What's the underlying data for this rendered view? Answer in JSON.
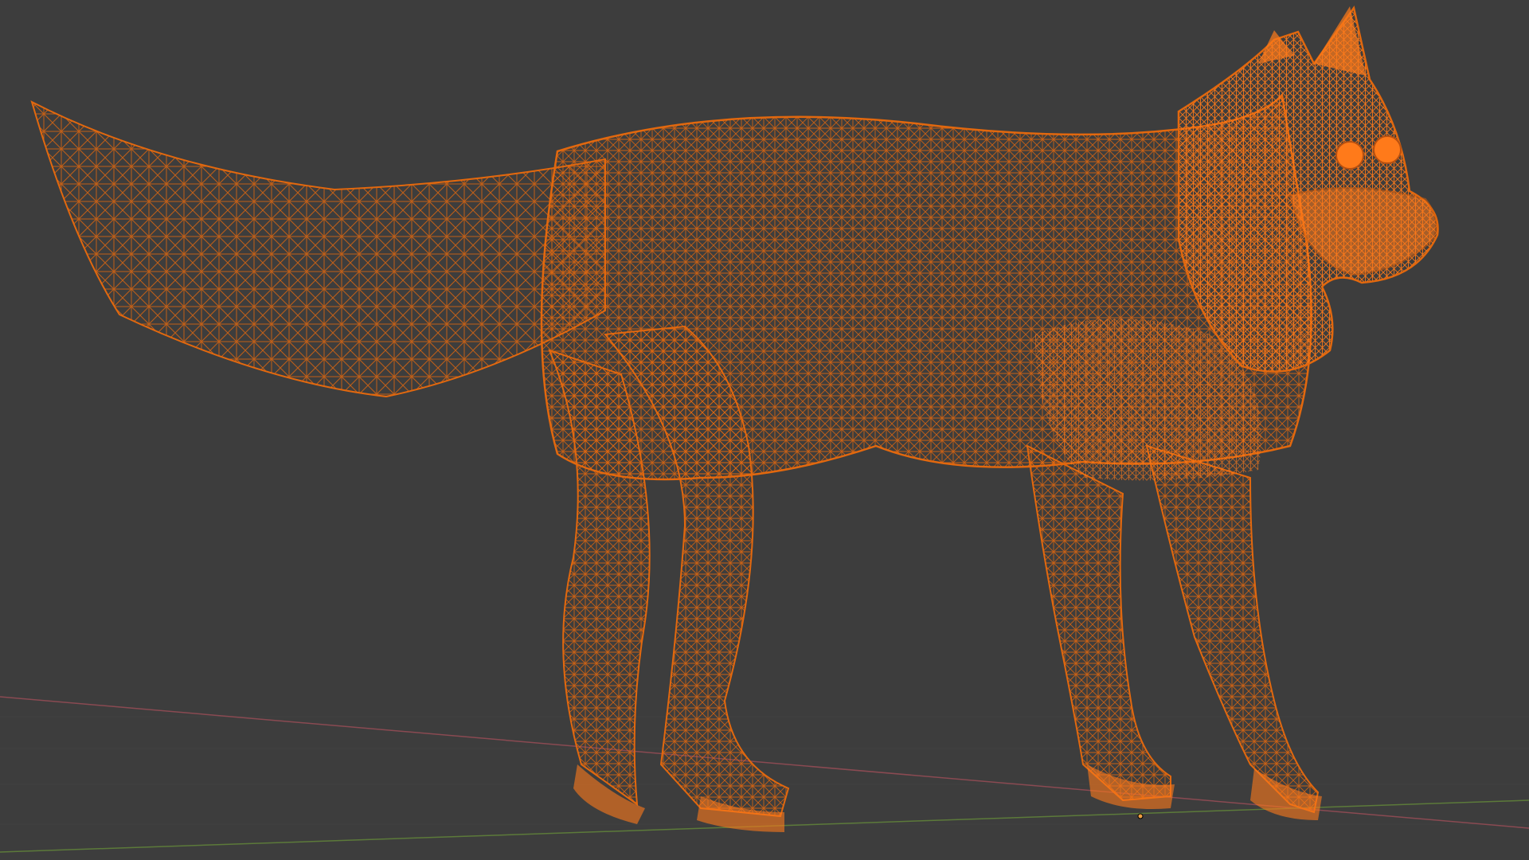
{
  "viewport": {
    "view_mode": "wireframe",
    "background_color": "#3d3d3d",
    "grid_floor": true,
    "selected_object": {
      "name": "",
      "icon": "wolf-mesh",
      "selection_color": "#ff7a1a",
      "outline_color": "#e2680e"
    },
    "axes": {
      "x_axis_color": "#8a4a52",
      "y_axis_color": "#5c7a3a"
    },
    "origin_marker_color": "#f0a040"
  }
}
